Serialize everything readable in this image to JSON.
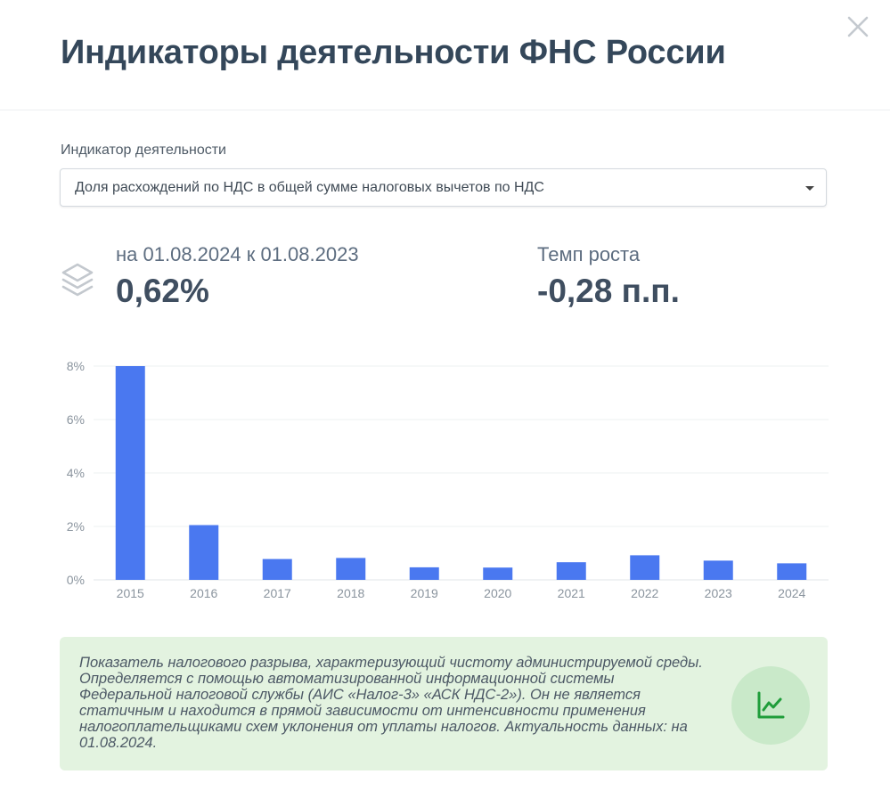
{
  "header": {
    "title": "Индикаторы деятельности ФНС России",
    "close_icon": "close-icon"
  },
  "indicator": {
    "label": "Индикатор деятельности",
    "selected": "Доля расхождений по НДС в общей сумме налоговых вычетов по НДС"
  },
  "stats": {
    "icon": "layers-icon",
    "period": "на 01.08.2024 к 01.08.2023",
    "value": "0,62%",
    "growth_label": "Темп роста",
    "growth_value": "-0,28 п.п."
  },
  "chart_data": {
    "type": "bar",
    "categories": [
      "2015",
      "2016",
      "2017",
      "2018",
      "2019",
      "2020",
      "2021",
      "2022",
      "2023",
      "2024"
    ],
    "values": [
      8.0,
      2.05,
      0.78,
      0.82,
      0.47,
      0.46,
      0.66,
      0.92,
      0.72,
      0.62
    ],
    "ylim": [
      0,
      8
    ],
    "yticks": [
      "0%",
      "2%",
      "4%",
      "6%",
      "8%"
    ],
    "ytick_values": [
      0,
      2,
      4,
      6,
      8
    ],
    "grid": true,
    "bar_color": "#4a78f0"
  },
  "info": {
    "text": "Показатель налогового разрыва, характеризующий чистоту администрируемой среды. Определяется с помощью автоматизированной информационной системы Федеральной налоговой службы (АИС «Налог-3» «АСК НДС-2»). Он не является статичным и находится в прямой зависимости от интенсивности применения налогоплательщиками схем уклонения от уплаты налогов. Актуальность данных: на 01.08.2024.",
    "button_icon": "trend-chart-icon"
  },
  "colors": {
    "accent_green": "#1f9d3a",
    "info_background": "#e3f3e0"
  }
}
